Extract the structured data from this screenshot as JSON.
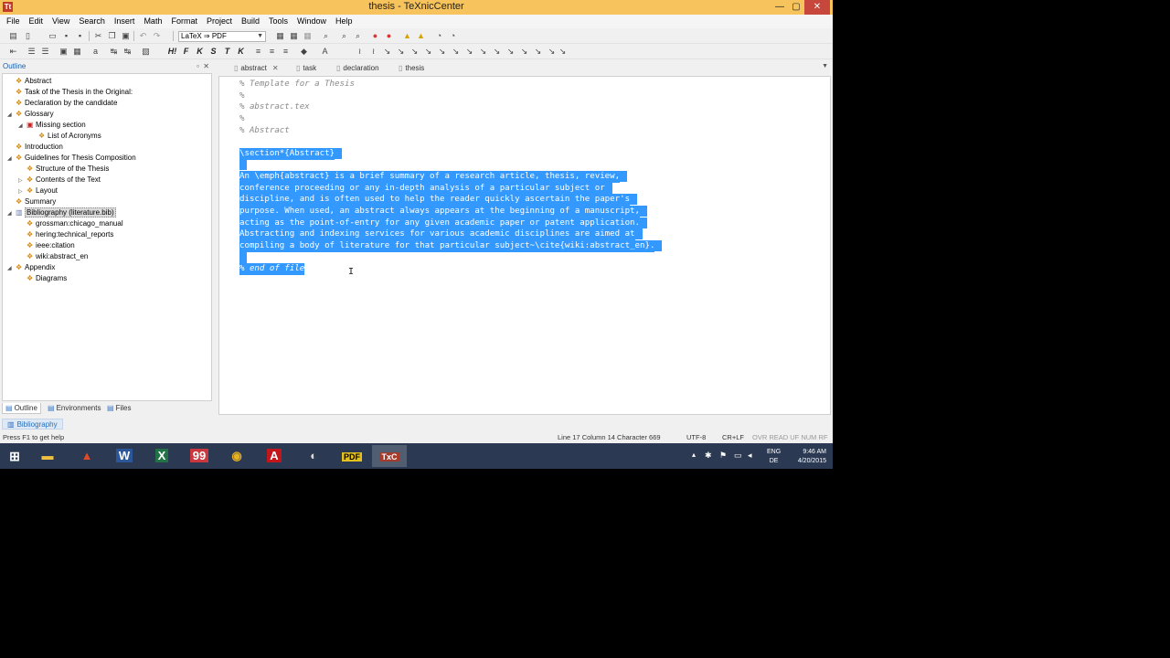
{
  "window": {
    "title": "thesis - TeXnicCenter",
    "app_icon": "Tt",
    "minimize": "—",
    "maximize": "▢",
    "close": "✕"
  },
  "menu": [
    "File",
    "Edit",
    "View",
    "Search",
    "Insert",
    "Math",
    "Format",
    "Project",
    "Build",
    "Tools",
    "Window",
    "Help"
  ],
  "toolbar": {
    "output_profile": "LaTeX ⇒ PDF"
  },
  "outline": {
    "header": "Outline",
    "items": [
      {
        "label": "Abstract",
        "twisty": "",
        "icon": "section-icon"
      },
      {
        "label": "Task of the Thesis in the Original:",
        "twisty": "",
        "icon": "section-icon"
      },
      {
        "label": "Declaration by the candidate",
        "twisty": "",
        "icon": "section-icon"
      },
      {
        "label": "Glossary",
        "twisty": "◢",
        "icon": "section-icon"
      },
      {
        "label": "Missing section",
        "twisty": "◢",
        "icon": "missing-file-icon"
      },
      {
        "label": "List of Acronyms",
        "twisty": "",
        "icon": "section-icon"
      },
      {
        "label": "Introduction",
        "twisty": "",
        "icon": "section-icon"
      },
      {
        "label": "Guidelines for Thesis Composition",
        "twisty": "◢",
        "icon": "section-icon"
      },
      {
        "label": "Structure of the Thesis",
        "twisty": "",
        "icon": "section-icon"
      },
      {
        "label": "Contents of the Text",
        "twisty": "▷",
        "icon": "section-icon"
      },
      {
        "label": "Layout",
        "twisty": "▷",
        "icon": "section-icon"
      },
      {
        "label": "Summary",
        "twisty": "",
        "icon": "section-icon"
      },
      {
        "label": "Bibliography (literature.bib)",
        "twisty": "◢",
        "icon": "bibliography-icon"
      },
      {
        "label": "grossman:chicago_manual",
        "twisty": "",
        "icon": "section-icon"
      },
      {
        "label": "hering:technical_reports",
        "twisty": "",
        "icon": "section-icon"
      },
      {
        "label": "ieee:citation",
        "twisty": "",
        "icon": "section-icon"
      },
      {
        "label": "wiki:abstract_en",
        "twisty": "",
        "icon": "section-icon"
      },
      {
        "label": "Appendix",
        "twisty": "◢",
        "icon": "section-icon"
      },
      {
        "label": "Diagrams",
        "twisty": "",
        "icon": "section-icon"
      }
    ],
    "tabs": [
      "Outline",
      "Environments",
      "Files"
    ],
    "bottom_tab": "Bibliography"
  },
  "editor": {
    "tabs": [
      "abstract",
      "task",
      "declaration",
      "thesis"
    ],
    "lines": [
      "% Template for a Thesis",
      "%",
      "% abstract.tex",
      "%",
      "% Abstract",
      "",
      "\\section*{Abstract}",
      "",
      "An \\emph{abstract} is a brief summary of a research article, thesis, review,",
      "conference proceeding or any in-depth analysis of a particular subject or",
      "discipline, and is often used to help the reader quickly ascertain the paper's",
      "purpose. When used, an abstract always appears at the beginning of a manuscript,",
      "acting as the point-of-entry for any given academic paper or patent application.",
      "Abstracting and indexing services for various academic disciplines are aimed at",
      "compiling a body of literature for that particular subject~\\cite{wiki:abstract_en}.",
      "",
      "% end of file"
    ],
    "cursor": "I"
  },
  "status": {
    "help": "Press F1 to get help",
    "position": "Line 17  Column 14  Character 669",
    "encoding": "UTF-8",
    "line_ending": "CR+LF",
    "flags": "OVR READ UF NUM RF"
  },
  "taskbar": {
    "lang": "ENG",
    "locale": "DE",
    "time": "9:46 AM",
    "date": "4/20/2015"
  }
}
